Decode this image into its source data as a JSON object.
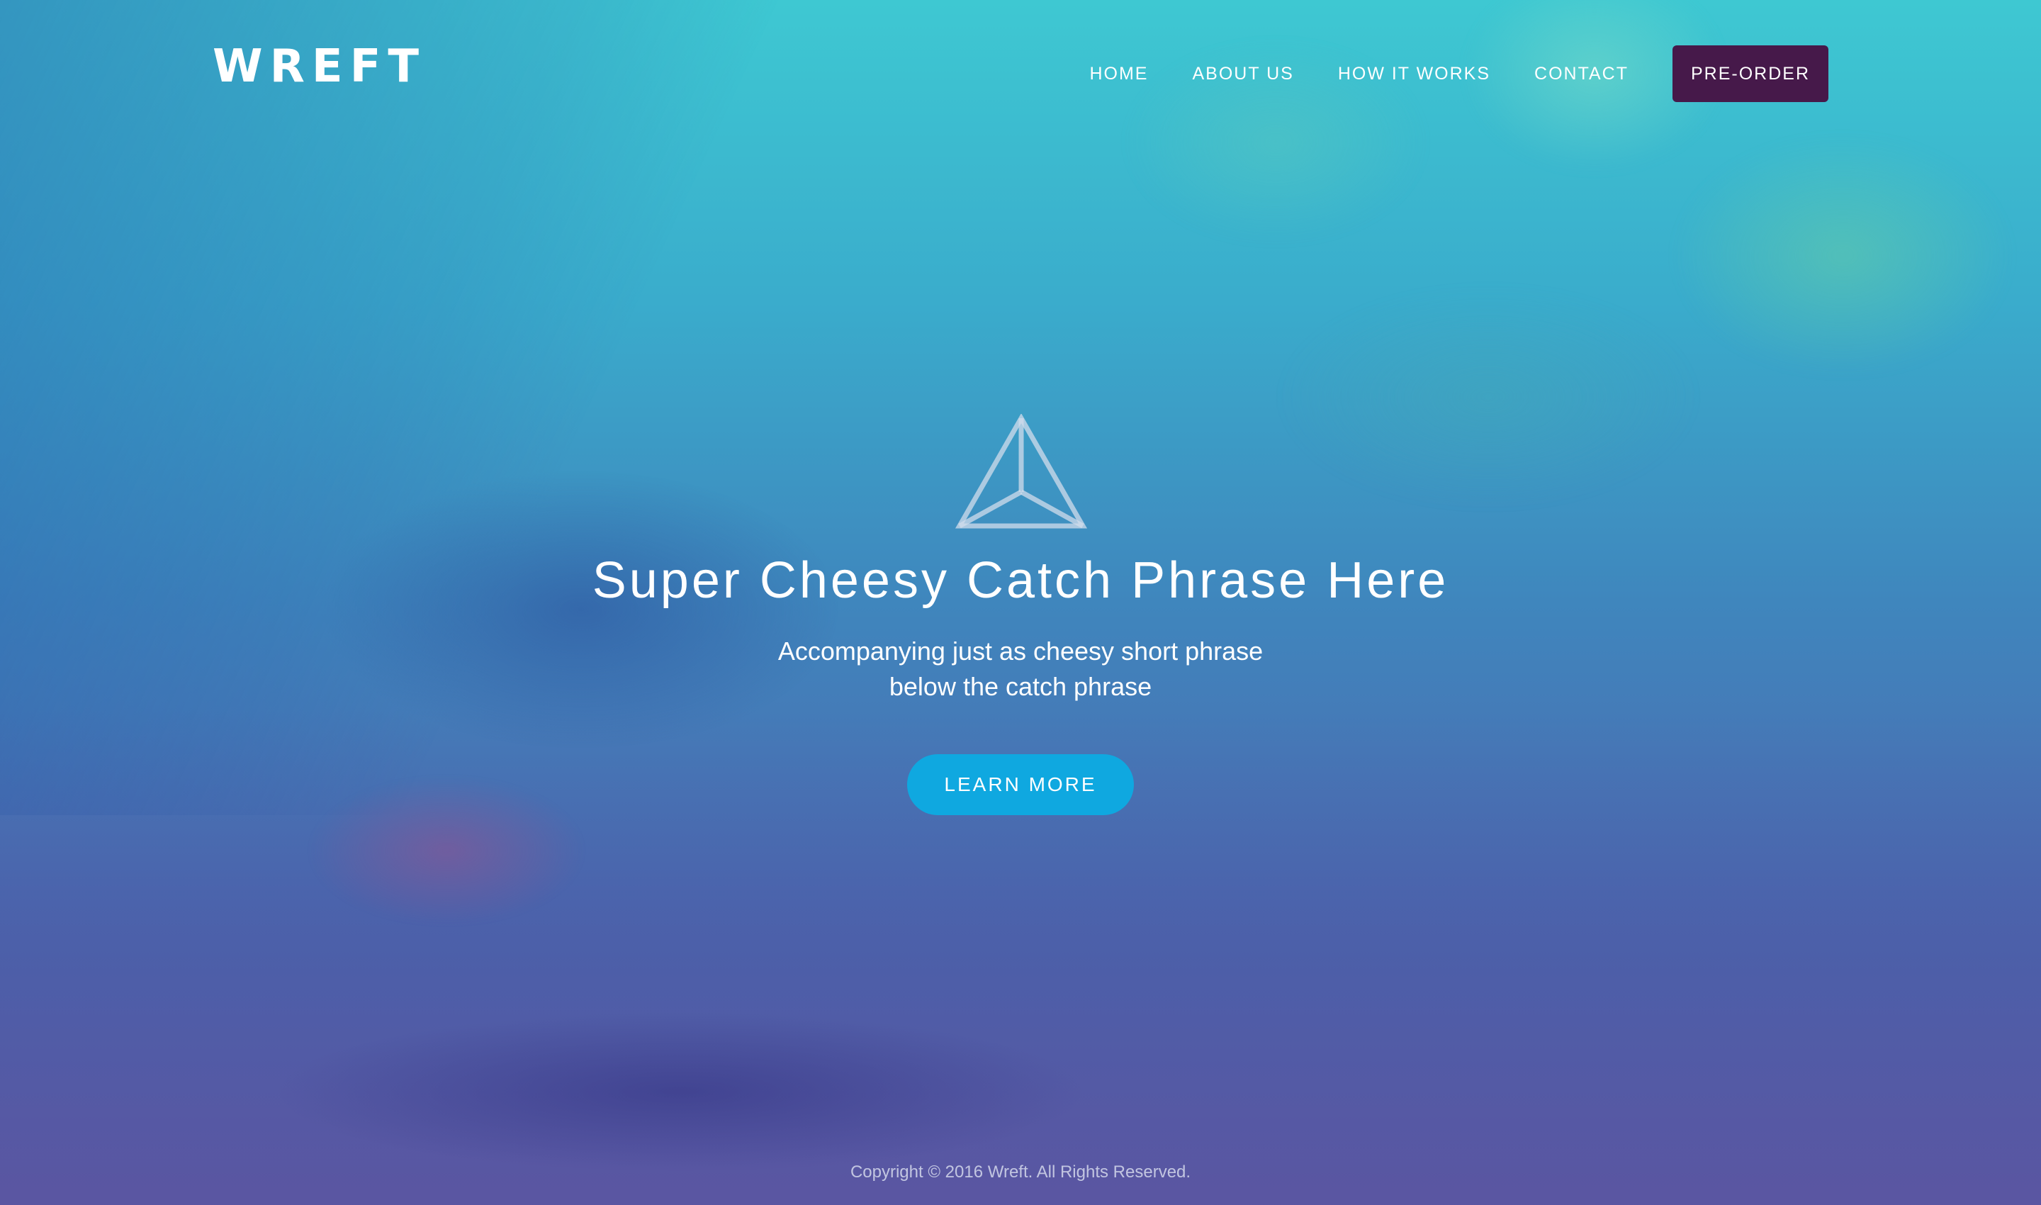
{
  "header": {
    "logo": "WREFT",
    "nav": [
      {
        "label": "HOME"
      },
      {
        "label": "ABOUT US"
      },
      {
        "label": "HOW IT WORKS"
      },
      {
        "label": "CONTACT"
      }
    ],
    "preorder_label": "PRE-ORDER"
  },
  "hero": {
    "icon": "pyramid-logo-icon",
    "title": "Super Cheesy Catch Phrase Here",
    "subtitle_line1": "Accompanying just as cheesy short phrase",
    "subtitle_line2": "below the catch phrase",
    "cta_label": "LEARN MORE"
  },
  "footer": {
    "copyright": "Copyright © 2016 Wreft. All Rights Reserved."
  },
  "colors": {
    "preorder_bg": "#46194a",
    "cta_bg": "#0fa8e0",
    "gradient_top": "#3ec8d2",
    "gradient_bottom": "#5b5aa3"
  }
}
